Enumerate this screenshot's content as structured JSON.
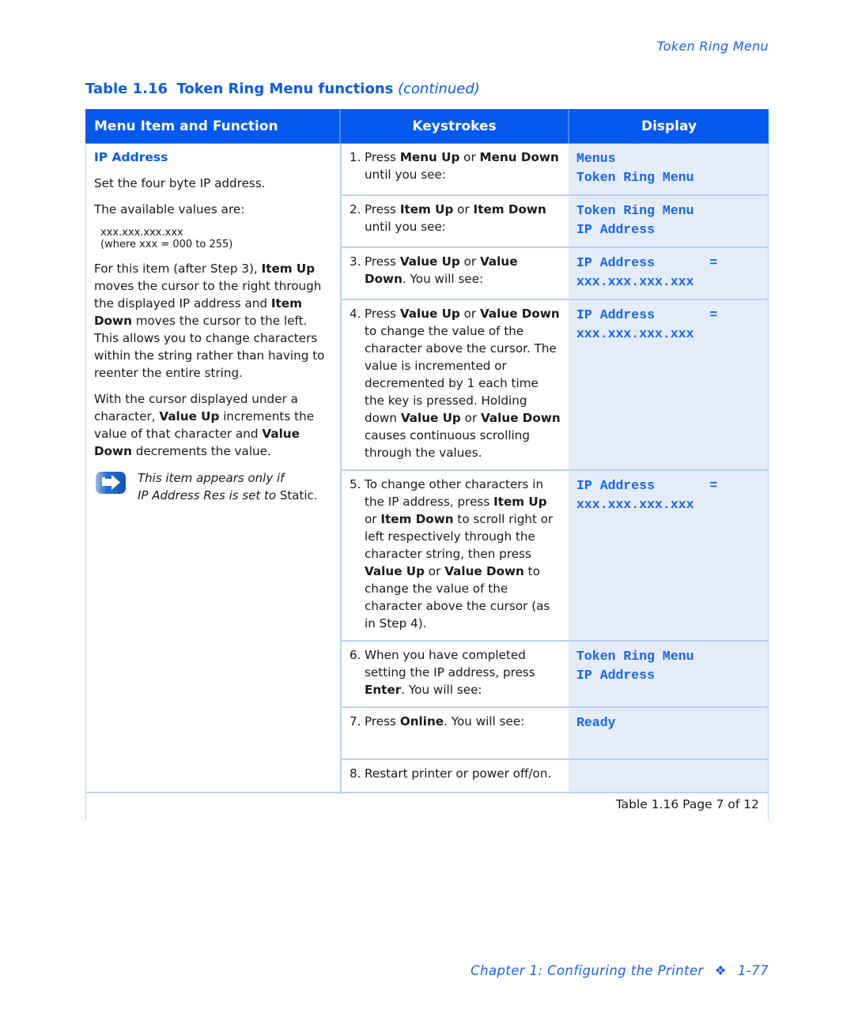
{
  "running_head": "Token Ring Menu",
  "table_title": {
    "number": "Table 1.16",
    "name": "Token Ring Menu functions",
    "continued": "(continued)"
  },
  "headers": {
    "col1": "Menu Item and Function",
    "col2": "Keystrokes",
    "col3": "Display"
  },
  "menu_item": {
    "title": "IP Address",
    "desc1": "Set the four byte IP address.",
    "desc2": "The available values are:",
    "values_line1": "xxx.xxx.xxx.xxx",
    "values_line2": "(where xxx = 000 to 255)",
    "para3": [
      {
        "t": "For this item (after Step 3), ",
        "b": false
      },
      {
        "t": "Item Up",
        "b": true
      },
      {
        "t": " moves the cursor to the right through the displayed IP address and ",
        "b": false
      },
      {
        "t": "Item Down",
        "b": true
      },
      {
        "t": " moves the cursor to the left. This allows you to change characters within the string rather than having to reenter the entire string.",
        "b": false
      }
    ],
    "para4": [
      {
        "t": "With the cursor displayed under a character, ",
        "b": false
      },
      {
        "t": "Value Up",
        "b": true
      },
      {
        "t": " increments the value of that character and ",
        "b": false
      },
      {
        "t": "Value Down",
        "b": true
      },
      {
        "t": " decrements the value.",
        "b": false
      }
    ],
    "note": {
      "icon": "arrow-right-note-icon",
      "line1": "This item appears only if",
      "line2_italic": "IP Address Res is set to ",
      "line2_plain": "Static."
    }
  },
  "steps": [
    {
      "num": "1.",
      "text": [
        {
          "t": "Press ",
          "b": false
        },
        {
          "t": "Menu Up",
          "b": true
        },
        {
          "t": " or ",
          "b": false
        },
        {
          "t": "Menu Down",
          "b": true
        },
        {
          "t": " until you see:",
          "b": false
        }
      ],
      "display": [
        "Menus",
        "Token Ring Menu"
      ]
    },
    {
      "num": "2.",
      "text": [
        {
          "t": "Press ",
          "b": false
        },
        {
          "t": "Item Up",
          "b": true
        },
        {
          "t": " or ",
          "b": false
        },
        {
          "t": "Item Down",
          "b": true
        },
        {
          "t": " until you see:",
          "b": false
        }
      ],
      "display": [
        "Token Ring Menu",
        "IP Address"
      ]
    },
    {
      "num": "3.",
      "text": [
        {
          "t": "Press ",
          "b": false
        },
        {
          "t": "Value Up",
          "b": true
        },
        {
          "t": " or ",
          "b": false
        },
        {
          "t": "Value Down",
          "b": true
        },
        {
          "t": ". You will see:",
          "b": false
        }
      ],
      "display": [
        "IP Address       =",
        "xxx.xxx.xxx.xxx"
      ]
    },
    {
      "num": "4.",
      "text": [
        {
          "t": "Press ",
          "b": false
        },
        {
          "t": "Value Up",
          "b": true
        },
        {
          "t": " or ",
          "b": false
        },
        {
          "t": "Value Down",
          "b": true
        },
        {
          "t": " to change the value of the character above the cursor. The value is incremented or decremented by 1 each time the key is pressed. Holding down ",
          "b": false
        },
        {
          "t": "Value Up",
          "b": true
        },
        {
          "t": " or ",
          "b": false
        },
        {
          "t": "Value Down",
          "b": true
        },
        {
          "t": " causes continuous scrolling through the values.",
          "b": false
        }
      ],
      "display": [
        "IP Address       =",
        "xxx.xxx.xxx.xxx"
      ]
    },
    {
      "num": "5.",
      "text": [
        {
          "t": "To change other characters in the IP address, press ",
          "b": false
        },
        {
          "t": "Item Up",
          "b": true
        },
        {
          "t": " or ",
          "b": false
        },
        {
          "t": "Item Down",
          "b": true
        },
        {
          "t": " to scroll right or left respectively through the character string, then press ",
          "b": false
        },
        {
          "t": "Value Up",
          "b": true
        },
        {
          "t": " or ",
          "b": false
        },
        {
          "t": "Value Down",
          "b": true
        },
        {
          "t": " to change the value of the character above the cursor (as in Step 4).",
          "b": false
        }
      ],
      "display": [
        "IP Address       =",
        "xxx.xxx.xxx.xxx"
      ]
    },
    {
      "num": "6.",
      "text": [
        {
          "t": "When you have completed setting the IP address, press ",
          "b": false
        },
        {
          "t": "Enter",
          "b": true
        },
        {
          "t": ". You will see:",
          "b": false
        }
      ],
      "display": [
        "Token Ring Menu",
        "IP Address"
      ]
    },
    {
      "num": "7.",
      "text": [
        {
          "t": "Press ",
          "b": false
        },
        {
          "t": "Online",
          "b": true
        },
        {
          "t": ". You will see:",
          "b": false
        }
      ],
      "display": [
        "Ready"
      ]
    },
    {
      "num": "8.",
      "text": [
        {
          "t": "Restart printer or power off/on.",
          "b": false
        }
      ],
      "display": []
    }
  ],
  "table_footer": "Table 1.16  Page 7 of 12",
  "page_footer": {
    "chapter": "Chapter 1: Configuring the Printer",
    "separator": "❖",
    "page": "1-77"
  }
}
